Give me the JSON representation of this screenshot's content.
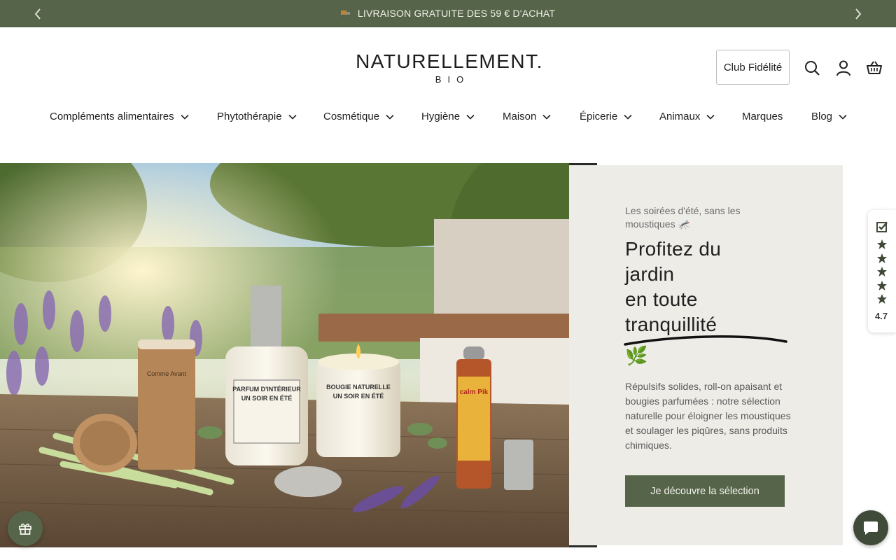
{
  "announcement": {
    "text": "LIVRAISON GRATUITE DES 59 € D'ACHAT",
    "icon": "truck-icon",
    "prev_icon": "chevron-left-icon",
    "next_icon": "chevron-right-icon"
  },
  "header": {
    "logo_name": "NATURELLEMENT.",
    "logo_sub": "BIO",
    "club_label": "Club Fidélité",
    "icons": [
      "search-icon",
      "account-icon",
      "basket-icon"
    ]
  },
  "nav": {
    "items": [
      {
        "label": "Compléments alimentaires",
        "has_dropdown": true
      },
      {
        "label": "Phytothérapie",
        "has_dropdown": true
      },
      {
        "label": "Cosmétique",
        "has_dropdown": true
      },
      {
        "label": "Hygiène",
        "has_dropdown": true
      },
      {
        "label": "Maison",
        "has_dropdown": true
      },
      {
        "label": "Épicerie",
        "has_dropdown": true
      },
      {
        "label": "Animaux",
        "has_dropdown": true
      },
      {
        "label": "Marques",
        "has_dropdown": false
      },
      {
        "label": "Blog",
        "has_dropdown": true
      }
    ]
  },
  "hero": {
    "eyebrow": "Les soirées d'été, sans les moustiques 🦟",
    "title_lines": [
      "Profitez du",
      "jardin",
      "en toute",
      "tranquillité"
    ],
    "leaf": "🌿",
    "description": "Répulsifs solides, roll-on apaisant et bougies parfumées : notre sélection naturelle pour éloigner les moustiques et soulager les piqûres, sans produits chimiques.",
    "cta_label": "Je découvre la sélection",
    "product_labels": {
      "candle": [
        "BOUGIE NATURELLE",
        "UN SOIR EN ÉTÉ"
      ],
      "perfume": [
        "PARFUM D'INTÉRIEUR",
        "UN SOIR EN ÉTÉ"
      ],
      "stick": "Comme Avant",
      "rollon": "calm Pik"
    }
  },
  "reviews_widget": {
    "score": "4.7",
    "stars": 5,
    "icon": "verified-check-icon"
  },
  "floating": {
    "rewards_icon": "gift-icon",
    "chat_icon": "chat-bubble-icon"
  },
  "colors": {
    "brand_green": "#56654a",
    "panel_bg": "#eeece7",
    "chat_bg": "#3f4a38"
  }
}
